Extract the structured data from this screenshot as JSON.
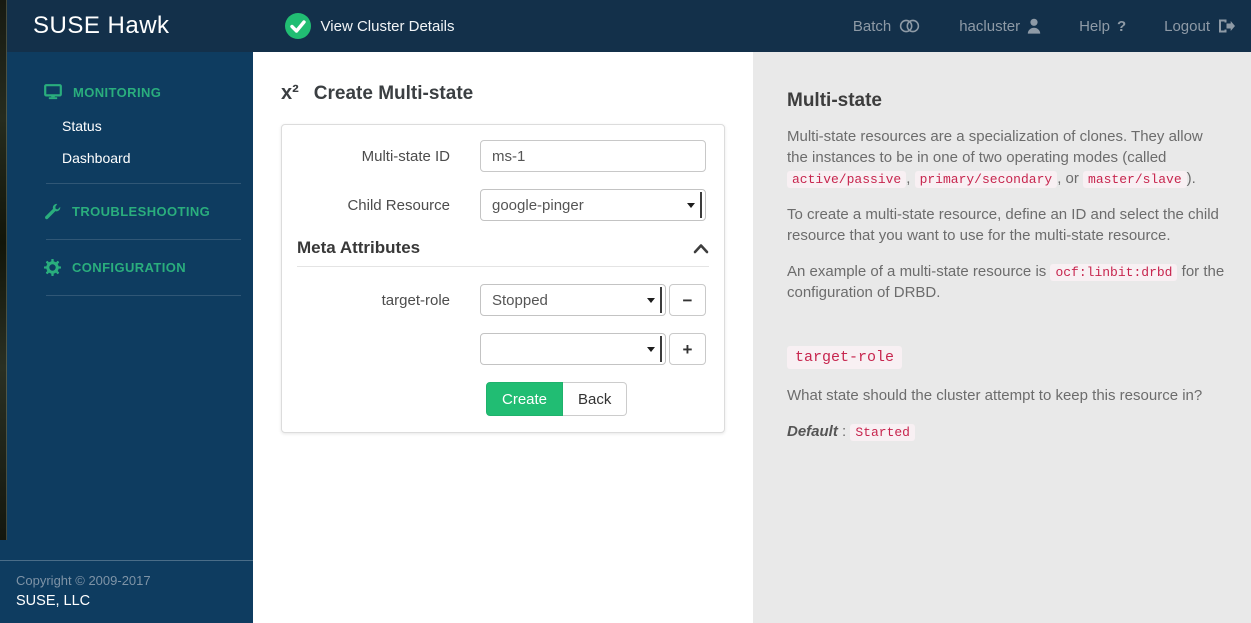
{
  "header": {
    "logo": "SUSE Hawk",
    "cluster_status_label": "View Cluster Details",
    "nav": [
      {
        "label": "Batch",
        "icon": "toggle-icon"
      },
      {
        "label": "hacluster",
        "icon": "user-icon"
      },
      {
        "label": "Help",
        "icon": "question-icon",
        "icon_glyph": "?"
      },
      {
        "label": "Logout",
        "icon": "sign-out-icon"
      }
    ]
  },
  "sidebar": {
    "sections": [
      {
        "label": "MONITORING",
        "icon": "monitor-icon",
        "items": [
          "Status",
          "Dashboard"
        ]
      },
      {
        "label": "TROUBLESHOOTING",
        "icon": "wrench-icon",
        "items": []
      },
      {
        "label": "CONFIGURATION",
        "icon": "gear-icon",
        "items": []
      }
    ],
    "footer": {
      "copyright": "Copyright © 2009-2017",
      "company": "SUSE, LLC"
    }
  },
  "form": {
    "title_icon": "x²",
    "title": "Create Multi-state",
    "fields": {
      "multistate_id": {
        "label": "Multi-state ID",
        "value": "ms-1"
      },
      "child_resource": {
        "label": "Child Resource",
        "value": "google-pinger"
      },
      "meta_section_title": "Meta Attributes",
      "target_role": {
        "label": "target-role",
        "value": "Stopped"
      },
      "new_attribute": {
        "value": ""
      }
    },
    "buttons": {
      "create": "Create",
      "back": "Back",
      "remove": "−",
      "add": "+"
    }
  },
  "help_panel": {
    "title": "Multi-state",
    "paragraphs": [
      {
        "segments": [
          {
            "t": "Multi-state resources are a specialization of clones. They allow the instances to be in one of two operating modes (called "
          },
          {
            "c": "active/passive"
          },
          {
            "t": ", "
          },
          {
            "c": "primary/secondary"
          },
          {
            "t": ", or "
          },
          {
            "c": "master/slave"
          },
          {
            "t": ")."
          }
        ]
      },
      {
        "segments": [
          {
            "t": "To create a multi-state resource, define an ID and select the child resource that you want to use for the multi-state resource."
          }
        ]
      },
      {
        "segments": [
          {
            "t": "An example of a multi-state resource is "
          },
          {
            "c": "ocf:linbit:drbd"
          },
          {
            "t": " for the configuration of DRBD."
          }
        ]
      }
    ],
    "attribute": {
      "name": "target-role",
      "description": "What state should the cluster attempt to keep this resource in?",
      "default_label": "Default",
      "default_separator": ":",
      "default_value": "Started"
    }
  },
  "colors": {
    "topbar_navy": "#13304a",
    "sidebar_blue": "#0e3c60",
    "accent_green": "#21bd73",
    "sidebar_green": "#2aae7d",
    "code_pink": "#c7254e",
    "help_panel_bg": "#e9e9e9"
  }
}
